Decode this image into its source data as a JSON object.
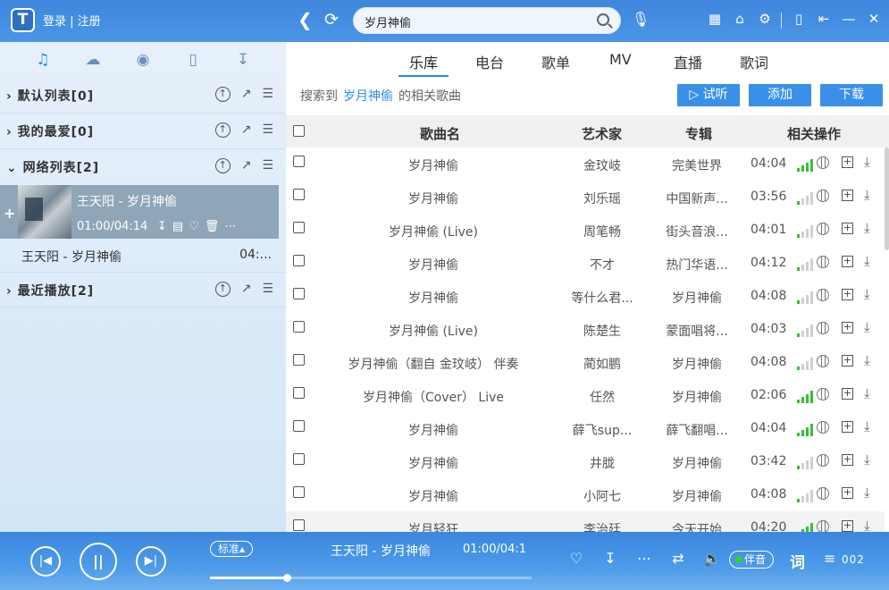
{
  "app": {
    "logo": "T",
    "login": "登录 | 注册"
  },
  "search": {
    "value": "岁月神偷",
    "placeholder": ""
  },
  "sidebar": {
    "tabs": [
      "music-icon",
      "cloud-icon",
      "radio-icon",
      "device-icon",
      "download-icon"
    ],
    "playlists": [
      {
        "title": "默认列表[0]"
      },
      {
        "title": "我的最爱[0]"
      },
      {
        "title": "网络列表[2]"
      },
      {
        "title": "最近播放[2]"
      }
    ],
    "now_playing": {
      "title": "王天阳 - 岁月神偷",
      "time": "01:00/04:14"
    },
    "sub_item": {
      "name": "王天阳 - 岁月神偷",
      "time": "04:..."
    }
  },
  "main": {
    "tabs": [
      "乐库",
      "电台",
      "歌单",
      "MV",
      "直播",
      "歌词"
    ],
    "result": {
      "prefix": "搜索到",
      "keyword": "岁月神偷",
      "suffix": "的相关歌曲"
    },
    "buttons": {
      "listen": "▷ 试听",
      "add": "添加",
      "download": "下载"
    },
    "columns": {
      "name": "歌曲名",
      "artist": "艺术家",
      "album": "专辑",
      "actions": "相关操作"
    },
    "rows": [
      {
        "name": "岁月神偷",
        "artist": "金玟岐",
        "album": "完美世界",
        "duration": "04:04",
        "quality": 4
      },
      {
        "name": "岁月神偷",
        "artist": "刘乐瑶",
        "album": "中国新声...",
        "duration": "03:56",
        "quality": 1
      },
      {
        "name": "岁月神偷 (Live)",
        "artist": "周笔畅",
        "album": "街头音浪...",
        "duration": "04:01",
        "quality": 1
      },
      {
        "name": "岁月神偷",
        "artist": "不才",
        "album": "热门华语...",
        "duration": "04:12",
        "quality": 1
      },
      {
        "name": "岁月神偷",
        "artist": "等什么君...",
        "album": "岁月神偷",
        "duration": "04:08",
        "quality": 1
      },
      {
        "name": "岁月神偷 (Live)",
        "artist": "陈楚生",
        "album": "蒙面唱将...",
        "duration": "04:03",
        "quality": 1
      },
      {
        "name": "岁月神偷（翻自 金玟岐） 伴奏",
        "artist": "蔺如鹏",
        "album": "岁月神偷",
        "duration": "04:08",
        "quality": 1
      },
      {
        "name": "岁月神偷（Cover） Live",
        "artist": "任然",
        "album": "岁月神偷",
        "duration": "02:06",
        "quality": 4
      },
      {
        "name": "岁月神偷",
        "artist": "薛飞sup...",
        "album": "薛飞翻唱...",
        "duration": "04:04",
        "quality": 4
      },
      {
        "name": "岁月神偷",
        "artist": "井胧",
        "album": "岁月神偷",
        "duration": "03:42",
        "quality": 1
      },
      {
        "name": "岁月神偷",
        "artist": "小阿七",
        "album": "岁月神偷",
        "duration": "04:08",
        "quality": 1
      },
      {
        "name": "岁月轻狂",
        "artist": "李治廷",
        "album": "今天开始",
        "duration": "04:20",
        "quality": 4
      }
    ]
  },
  "player": {
    "quality": "标准▴",
    "title": "王天阳 - 岁月神偷",
    "time": "01:00/04:1",
    "progress": 0.24,
    "tone": "伴音",
    "lyric": "词",
    "queue_count": "002"
  },
  "colors": {
    "accent": "#2b8ae8",
    "topbar": "#4b95e6",
    "signal_on": "#33c233"
  }
}
